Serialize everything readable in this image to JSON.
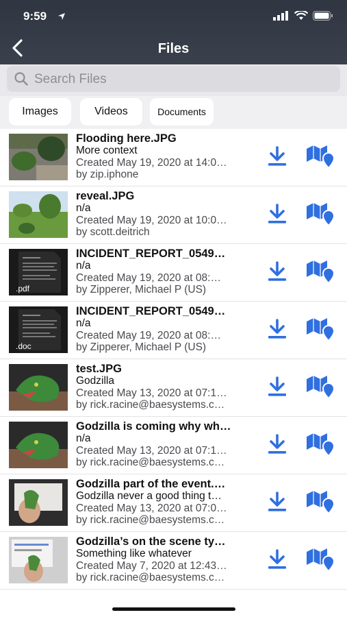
{
  "status": {
    "time": "9:59"
  },
  "header": {
    "title": "Files"
  },
  "search": {
    "placeholder": "Search Files"
  },
  "filters": [
    "Images",
    "Videos",
    "Documents"
  ],
  "files": [
    {
      "name": "Flooding here.JPG",
      "description": "More context",
      "created": "Created May 19, 2020 at 14:0…",
      "author": "by zip.iphone",
      "thumb": "photo-garden"
    },
    {
      "name": "reveal.JPG",
      "description": "n/a",
      "created": "Created May 19, 2020 at 10:0…",
      "author": "by scott.deitrich",
      "thumb": "photo-yard"
    },
    {
      "name": "INCIDENT_REPORT_0549…",
      "description": "n/a",
      "created": "Created May 19, 2020 at 08:…",
      "author": "by Zipperer, Michael P (US)",
      "thumb": "doc",
      "ext": ".pdf"
    },
    {
      "name": "INCIDENT_REPORT_0549…",
      "description": "n/a",
      "created": "Created May 19, 2020 at 08:…",
      "author": "by Zipperer, Michael P (US)",
      "thumb": "doc",
      "ext": ".doc"
    },
    {
      "name": "test.JPG",
      "description": "Godzilla",
      "created": "Created May 13, 2020 at 07:1…",
      "author": "by rick.racine@baesystems.c…",
      "thumb": "photo-godzilla"
    },
    {
      "name": "Godzilla is coming why wh…",
      "description": "n/a",
      "created": "Created May 13, 2020 at 07:1…",
      "author": "by rick.racine@baesystems.c…",
      "thumb": "photo-godzilla"
    },
    {
      "name": "Godzilla part of the event.…",
      "description": "Godzilla never a good thing t…",
      "created": "Created May 13, 2020 at 07:0…",
      "author": "by rick.racine@baesystems.c…",
      "thumb": "photo-hand"
    },
    {
      "name": "Godzilla’s on the scene ty…",
      "description": "Something like whatever",
      "created": "Created May 7, 2020 at 12:43…",
      "author": "by rick.racine@baesystems.c…",
      "thumb": "photo-screen"
    }
  ],
  "colors": {
    "accent": "#2f6fe0",
    "header": "#343a46"
  }
}
